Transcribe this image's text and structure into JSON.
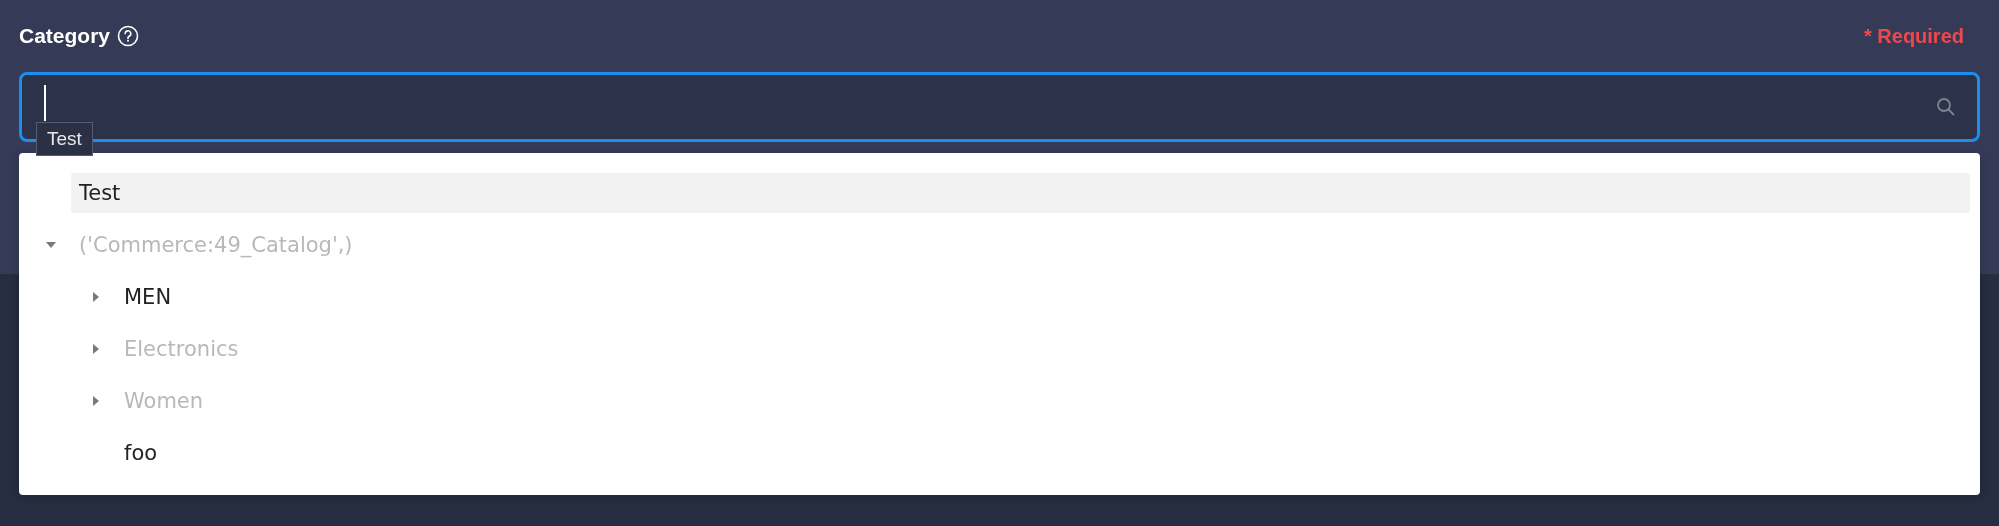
{
  "field": {
    "label": "Category",
    "required_note": "* Required",
    "focused": true
  },
  "tooltip": "Test",
  "tree": [
    {
      "label": "Test",
      "disabled": false,
      "active": true
    },
    {
      "label": "('Commerce:49_Catalog',)",
      "disabled": true,
      "active": false,
      "expandable": true,
      "expanded": true,
      "children": [
        {
          "label": "MEN",
          "disabled": false,
          "active": false,
          "expandable": true,
          "expanded": false
        },
        {
          "label": "Electronics",
          "disabled": true,
          "active": false,
          "expandable": true,
          "expanded": false
        },
        {
          "label": "Women",
          "disabled": true,
          "active": false,
          "expandable": true,
          "expanded": false
        },
        {
          "label": "foo",
          "disabled": false,
          "active": false
        }
      ]
    }
  ]
}
